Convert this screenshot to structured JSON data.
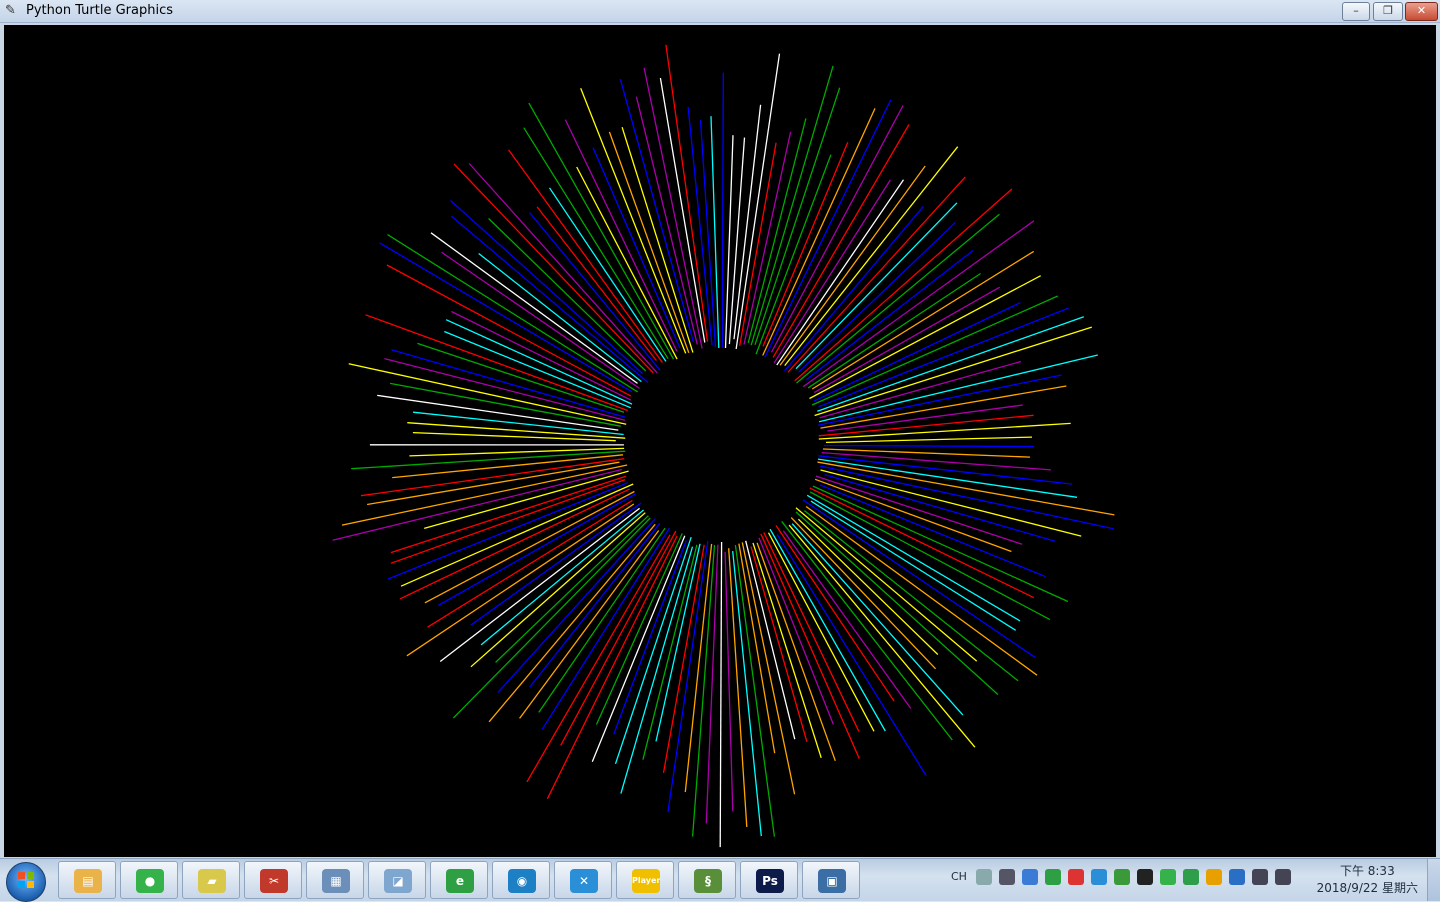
{
  "window": {
    "title": "Python Turtle Graphics",
    "controls": {
      "minimize": "–",
      "maximize": "❐",
      "close": "✕"
    }
  },
  "canvas": {
    "background": "#000000",
    "drawing": {
      "type": "radial-starburst",
      "center_fill": "#000000",
      "palette": [
        "#ff0000",
        "#0000ff",
        "#ffff00",
        "#00ffff",
        "#ffffff",
        "#00aa00",
        "#aa00aa",
        "#ffa500"
      ]
    }
  },
  "taskbar": {
    "apps": [
      {
        "name": "file-explorer",
        "color": "#e9b34a",
        "glyph": "▤"
      },
      {
        "name": "wechat",
        "color": "#35b34a",
        "glyph": "●"
      },
      {
        "name": "sticky-notes",
        "color": "#d8c94c",
        "glyph": "▰"
      },
      {
        "name": "snipping-tool",
        "color": "#c0392b",
        "glyph": "✂"
      },
      {
        "name": "calculator",
        "color": "#6b8fb8",
        "glyph": "▦"
      },
      {
        "name": "notepad",
        "color": "#7fa6cf",
        "glyph": "◪"
      },
      {
        "name": "browser-360",
        "color": "#2ea043",
        "glyph": "e"
      },
      {
        "name": "qq-browser",
        "color": "#1d7fc4",
        "glyph": "◉"
      },
      {
        "name": "xmind",
        "color": "#2a8fd6",
        "glyph": "✕"
      },
      {
        "name": "player",
        "color": "#f0c000",
        "glyph": "Player"
      },
      {
        "name": "python-idle",
        "color": "#5a8f3a",
        "glyph": "§"
      },
      {
        "name": "photoshop",
        "color": "#0d1b4a",
        "glyph": "Ps"
      },
      {
        "name": "python",
        "color": "#3a6ea5",
        "glyph": "▣"
      }
    ],
    "tray": {
      "language": "CH",
      "icons": [
        "keyboard",
        "ime",
        "onedrive",
        "360-safe",
        "qq-music",
        "xmind-tray",
        "shield",
        "qq",
        "wechat-tray",
        "360-guard",
        "browser",
        "network-grid",
        "network",
        "volume"
      ]
    },
    "clock": {
      "time": "下午 8:33",
      "date": "2018/9/22 星期六"
    }
  }
}
